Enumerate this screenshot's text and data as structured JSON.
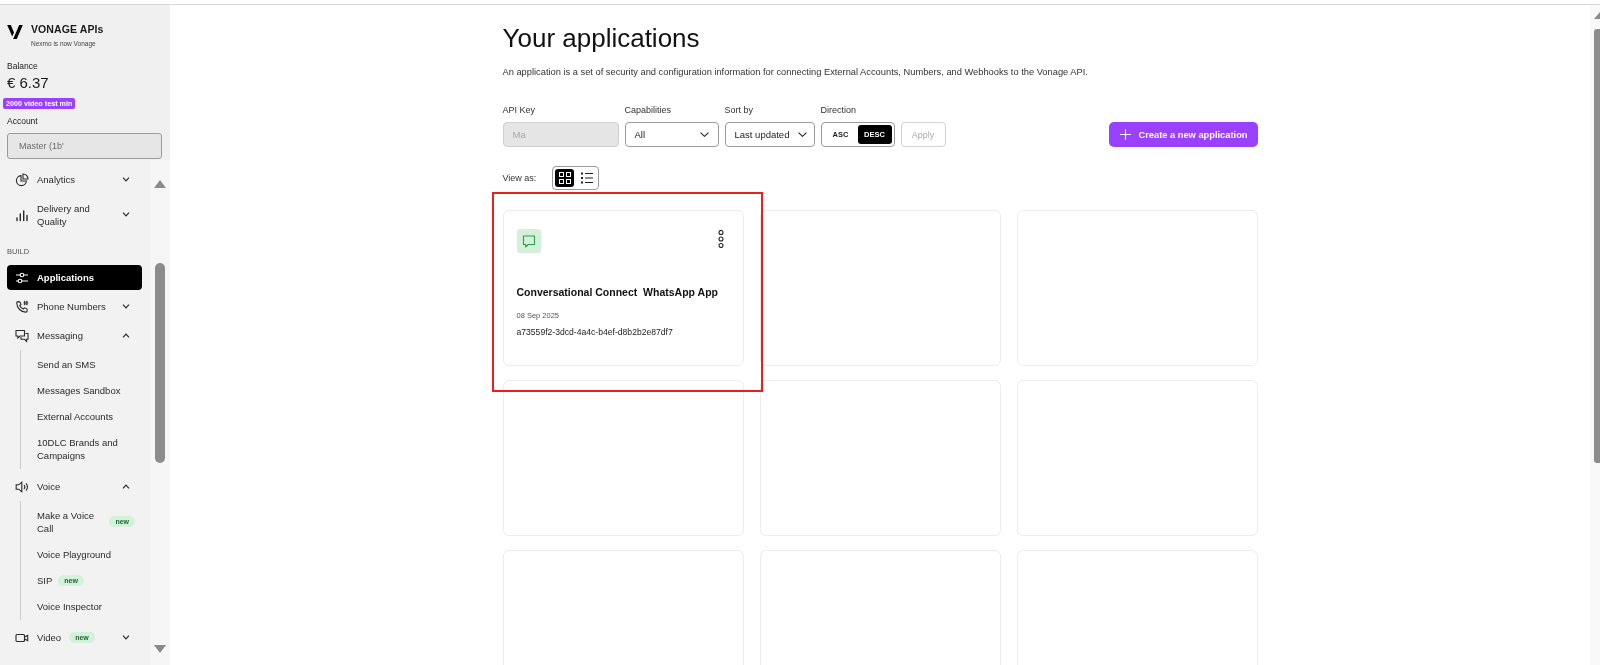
{
  "sidebar": {
    "brand": {
      "name": "VONAGE APIs",
      "tagline": "Nexmo is now Vonage"
    },
    "balance": {
      "label": "Balance",
      "amount": "€ 6.37",
      "badge": "2000 video test min"
    },
    "account": {
      "label": "Account",
      "value": "Master (1b'",
      "disabled": true
    },
    "nav": [
      {
        "kind": "group",
        "label": "Analytics",
        "selected": false,
        "expanded": false
      },
      {
        "kind": "group",
        "label": "Delivery and Quality",
        "selected": false,
        "expanded": false
      },
      {
        "kind": "heading",
        "label": "BUILD"
      },
      {
        "kind": "link",
        "label": "Applications",
        "selected": true
      },
      {
        "kind": "group",
        "label": "Phone Numbers",
        "selected": false,
        "expanded": false
      },
      {
        "kind": "group",
        "label": "Messaging",
        "selected": false,
        "expanded": true,
        "children": [
          {
            "label": "Send an SMS",
            "selected": false
          },
          {
            "label": "Messages Sandbox",
            "selected": false
          },
          {
            "label": "External Accounts",
            "selected": false
          },
          {
            "label": "10DLC Brands and Campaigns",
            "selected": false
          }
        ]
      },
      {
        "kind": "group",
        "label": "Voice",
        "selected": false,
        "expanded": true,
        "children": [
          {
            "label": "Make a Voice Call",
            "badge": "new",
            "selected": false
          },
          {
            "label": "Voice Playground",
            "selected": false
          },
          {
            "label": "SIP",
            "badge": "new",
            "selected": false
          },
          {
            "label": "Voice Inspector",
            "selected": false
          }
        ]
      },
      {
        "kind": "group",
        "label": "Video",
        "badge": "new",
        "selected": false,
        "expanded": false
      }
    ]
  },
  "main": {
    "title": "Your applications",
    "description": "An application is a set of security and configuration information for connecting External Accounts, Numbers, and Webhooks to the Vonage API.",
    "filters": [
      {
        "kind": "text",
        "label": "API Key",
        "placeholder": "Ma",
        "disabled": true
      },
      {
        "kind": "select",
        "label": "Capabilities",
        "value": "All",
        "disabled": false
      },
      {
        "kind": "select",
        "label": "Sort by",
        "value": "Last updated",
        "disabled": false
      },
      {
        "kind": "segmented",
        "label": "Direction",
        "disabled": false,
        "options": [
          {
            "label": "ASC",
            "selected": false
          },
          {
            "label": "DESC",
            "selected": true
          }
        ]
      }
    ],
    "apply_button": {
      "label": "Apply",
      "disabled": true
    },
    "create_button": {
      "label": "Create a new application"
    },
    "view_toggle": {
      "label": "View as:",
      "options": [
        {
          "selected": true
        },
        {
          "selected": false
        }
      ]
    },
    "cards": [
      {
        "kind": "app",
        "highlighted": true,
        "title": "Conversational Connect  WhatsApp App",
        "date": "08 Sep 2025",
        "app_id": "a73559f2-3dcd-4a4c-b4ef-d8b2b2e87df7"
      },
      {
        "kind": "blank"
      },
      {
        "kind": "blank"
      },
      {
        "kind": "blank"
      },
      {
        "kind": "blank"
      },
      {
        "kind": "blank"
      },
      {
        "kind": "blank"
      },
      {
        "kind": "blank"
      },
      {
        "kind": "blank"
      }
    ]
  }
}
